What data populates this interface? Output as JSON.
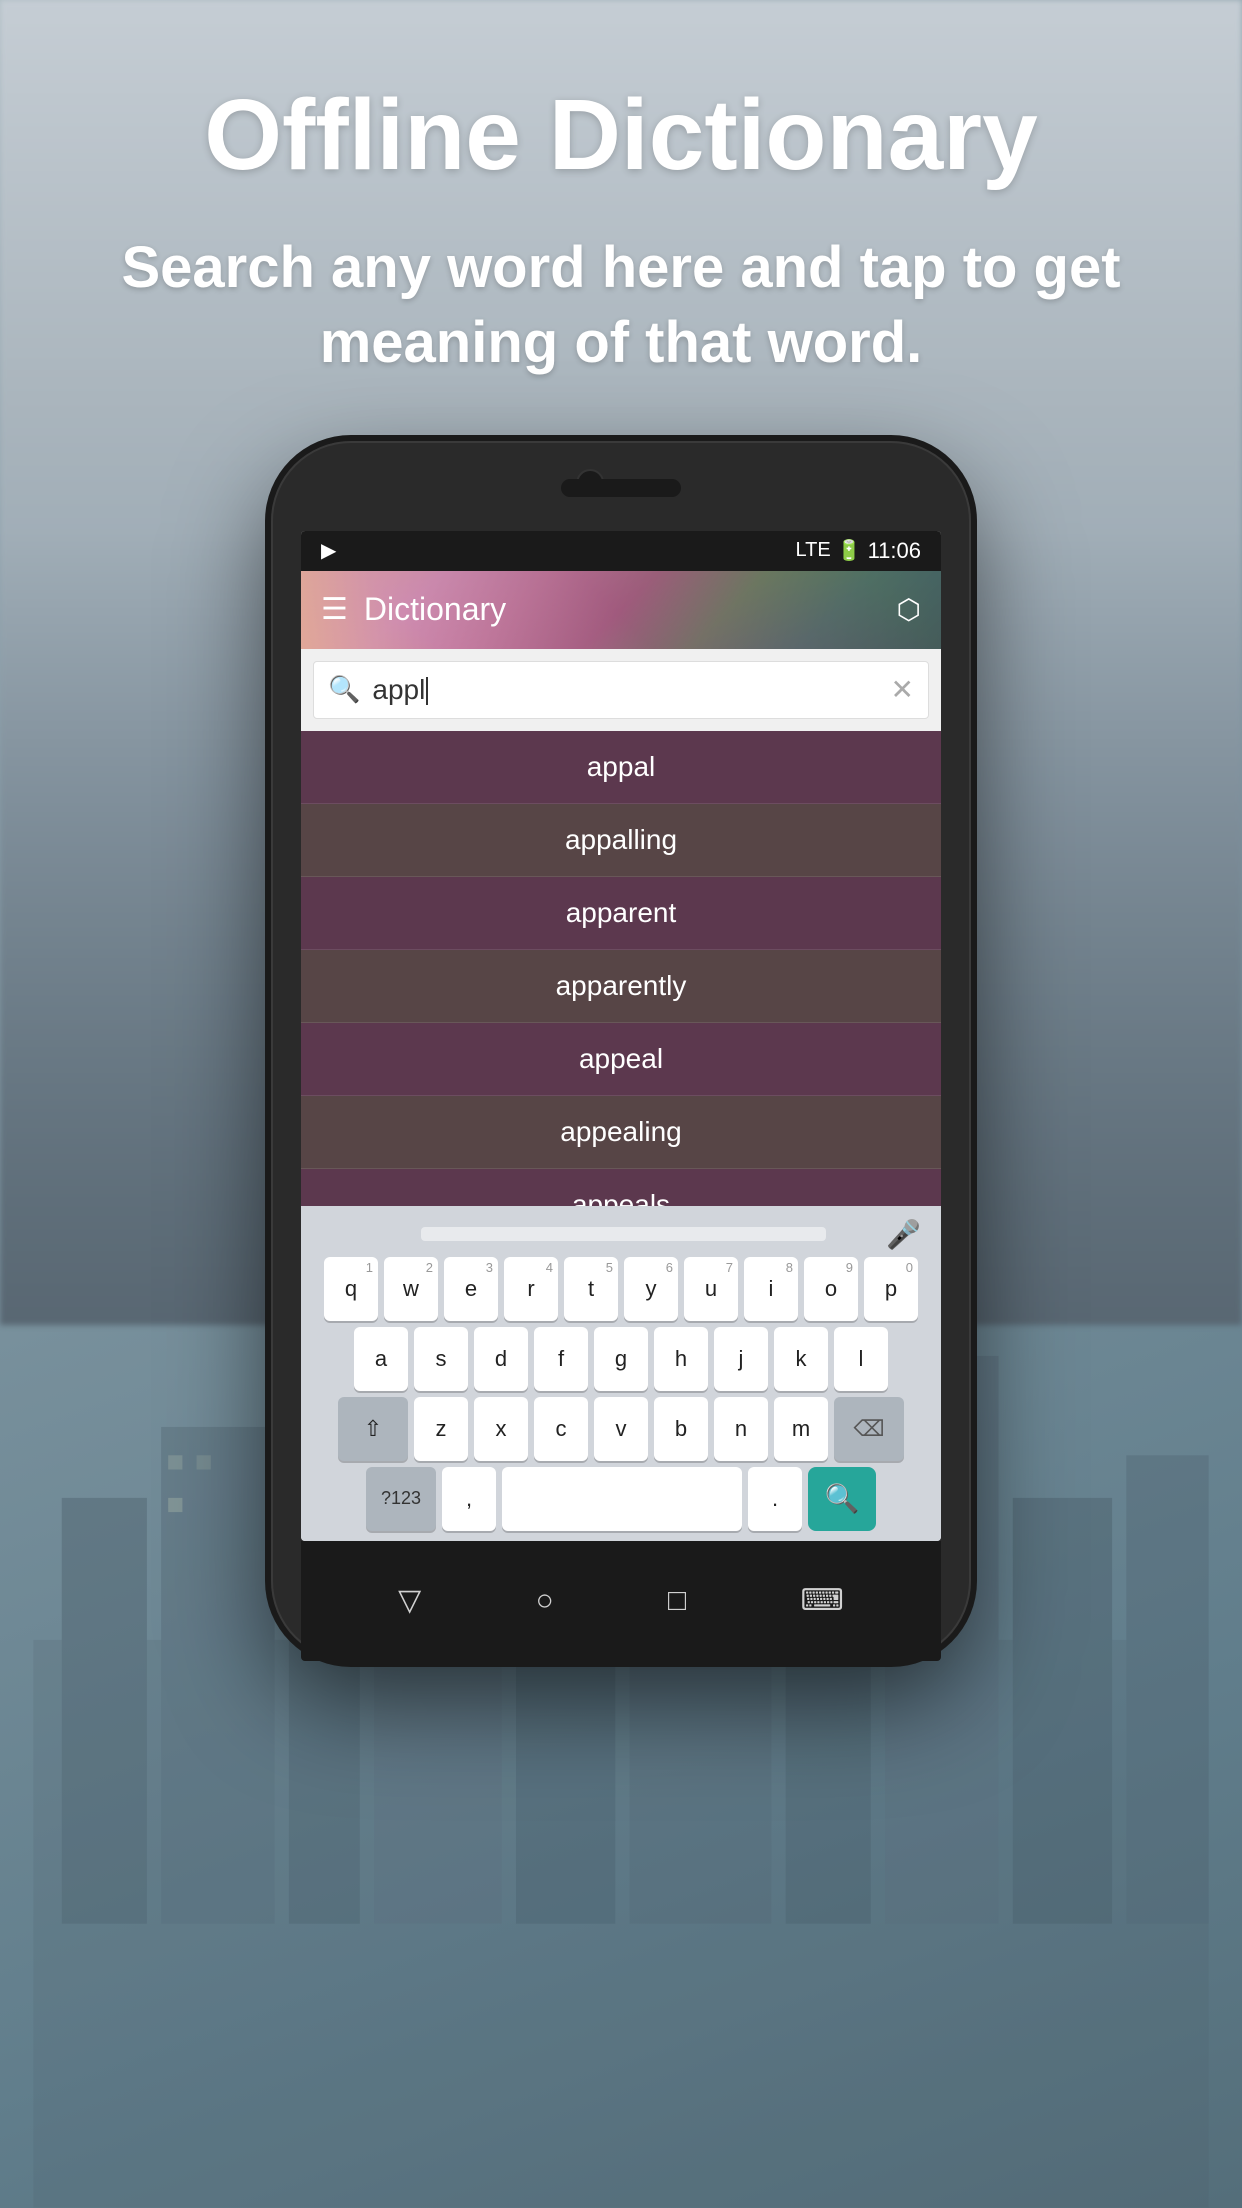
{
  "background": {
    "color": "#8fa0ac"
  },
  "hero": {
    "title": "Offline Dictionary",
    "subtitle": "Search any word here and tap to get meaning of that word."
  },
  "phone": {
    "status_bar": {
      "left_icon": "play-icon",
      "signal": "LTE",
      "battery": "⚡",
      "time": "11:06"
    },
    "header": {
      "menu_icon": "☰",
      "title": "Dictionary",
      "share_icon": "⬡"
    },
    "search": {
      "placeholder": "appl",
      "clear_icon": "✕"
    },
    "suggestions": [
      "appal",
      "appalling",
      "apparent",
      "apparently",
      "appeal",
      "appealing",
      "appeals"
    ],
    "keyboard": {
      "rows": [
        [
          "q",
          "w",
          "e",
          "r",
          "t",
          "y",
          "u",
          "i",
          "o",
          "p"
        ],
        [
          "a",
          "s",
          "d",
          "f",
          "g",
          "h",
          "j",
          "k",
          "l"
        ],
        [
          "z",
          "x",
          "c",
          "v",
          "b",
          "n",
          "m"
        ]
      ],
      "num_row": [
        "1",
        "2",
        "3",
        "4",
        "5",
        "6",
        "7",
        "8",
        "9",
        "0"
      ],
      "special_keys": {
        "shift": "⇧",
        "backspace": "⌫",
        "symbols": "?123",
        "comma": ",",
        "period": ".",
        "search": "🔍"
      }
    },
    "bottom_nav": {
      "back": "▽",
      "home": "○",
      "recent": "□",
      "keyboard": "⌨"
    }
  }
}
